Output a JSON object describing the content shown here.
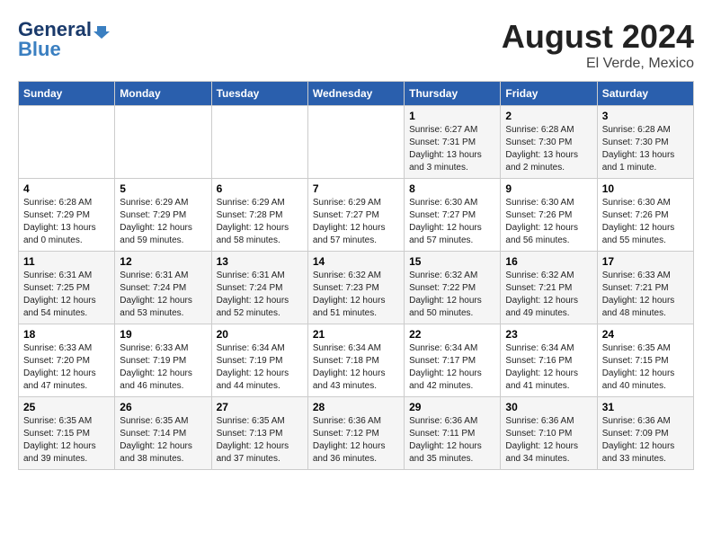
{
  "logo": {
    "general": "General",
    "blue": "Blue"
  },
  "title": {
    "month_year": "August 2024",
    "location": "El Verde, Mexico"
  },
  "days_of_week": [
    "Sunday",
    "Monday",
    "Tuesday",
    "Wednesday",
    "Thursday",
    "Friday",
    "Saturday"
  ],
  "weeks": [
    [
      {
        "num": "",
        "info": ""
      },
      {
        "num": "",
        "info": ""
      },
      {
        "num": "",
        "info": ""
      },
      {
        "num": "",
        "info": ""
      },
      {
        "num": "1",
        "info": "Sunrise: 6:27 AM\nSunset: 7:31 PM\nDaylight: 13 hours\nand 3 minutes."
      },
      {
        "num": "2",
        "info": "Sunrise: 6:28 AM\nSunset: 7:30 PM\nDaylight: 13 hours\nand 2 minutes."
      },
      {
        "num": "3",
        "info": "Sunrise: 6:28 AM\nSunset: 7:30 PM\nDaylight: 13 hours\nand 1 minute."
      }
    ],
    [
      {
        "num": "4",
        "info": "Sunrise: 6:28 AM\nSunset: 7:29 PM\nDaylight: 13 hours\nand 0 minutes."
      },
      {
        "num": "5",
        "info": "Sunrise: 6:29 AM\nSunset: 7:29 PM\nDaylight: 12 hours\nand 59 minutes."
      },
      {
        "num": "6",
        "info": "Sunrise: 6:29 AM\nSunset: 7:28 PM\nDaylight: 12 hours\nand 58 minutes."
      },
      {
        "num": "7",
        "info": "Sunrise: 6:29 AM\nSunset: 7:27 PM\nDaylight: 12 hours\nand 57 minutes."
      },
      {
        "num": "8",
        "info": "Sunrise: 6:30 AM\nSunset: 7:27 PM\nDaylight: 12 hours\nand 57 minutes."
      },
      {
        "num": "9",
        "info": "Sunrise: 6:30 AM\nSunset: 7:26 PM\nDaylight: 12 hours\nand 56 minutes."
      },
      {
        "num": "10",
        "info": "Sunrise: 6:30 AM\nSunset: 7:26 PM\nDaylight: 12 hours\nand 55 minutes."
      }
    ],
    [
      {
        "num": "11",
        "info": "Sunrise: 6:31 AM\nSunset: 7:25 PM\nDaylight: 12 hours\nand 54 minutes."
      },
      {
        "num": "12",
        "info": "Sunrise: 6:31 AM\nSunset: 7:24 PM\nDaylight: 12 hours\nand 53 minutes."
      },
      {
        "num": "13",
        "info": "Sunrise: 6:31 AM\nSunset: 7:24 PM\nDaylight: 12 hours\nand 52 minutes."
      },
      {
        "num": "14",
        "info": "Sunrise: 6:32 AM\nSunset: 7:23 PM\nDaylight: 12 hours\nand 51 minutes."
      },
      {
        "num": "15",
        "info": "Sunrise: 6:32 AM\nSunset: 7:22 PM\nDaylight: 12 hours\nand 50 minutes."
      },
      {
        "num": "16",
        "info": "Sunrise: 6:32 AM\nSunset: 7:21 PM\nDaylight: 12 hours\nand 49 minutes."
      },
      {
        "num": "17",
        "info": "Sunrise: 6:33 AM\nSunset: 7:21 PM\nDaylight: 12 hours\nand 48 minutes."
      }
    ],
    [
      {
        "num": "18",
        "info": "Sunrise: 6:33 AM\nSunset: 7:20 PM\nDaylight: 12 hours\nand 47 minutes."
      },
      {
        "num": "19",
        "info": "Sunrise: 6:33 AM\nSunset: 7:19 PM\nDaylight: 12 hours\nand 46 minutes."
      },
      {
        "num": "20",
        "info": "Sunrise: 6:34 AM\nSunset: 7:19 PM\nDaylight: 12 hours\nand 44 minutes."
      },
      {
        "num": "21",
        "info": "Sunrise: 6:34 AM\nSunset: 7:18 PM\nDaylight: 12 hours\nand 43 minutes."
      },
      {
        "num": "22",
        "info": "Sunrise: 6:34 AM\nSunset: 7:17 PM\nDaylight: 12 hours\nand 42 minutes."
      },
      {
        "num": "23",
        "info": "Sunrise: 6:34 AM\nSunset: 7:16 PM\nDaylight: 12 hours\nand 41 minutes."
      },
      {
        "num": "24",
        "info": "Sunrise: 6:35 AM\nSunset: 7:15 PM\nDaylight: 12 hours\nand 40 minutes."
      }
    ],
    [
      {
        "num": "25",
        "info": "Sunrise: 6:35 AM\nSunset: 7:15 PM\nDaylight: 12 hours\nand 39 minutes."
      },
      {
        "num": "26",
        "info": "Sunrise: 6:35 AM\nSunset: 7:14 PM\nDaylight: 12 hours\nand 38 minutes."
      },
      {
        "num": "27",
        "info": "Sunrise: 6:35 AM\nSunset: 7:13 PM\nDaylight: 12 hours\nand 37 minutes."
      },
      {
        "num": "28",
        "info": "Sunrise: 6:36 AM\nSunset: 7:12 PM\nDaylight: 12 hours\nand 36 minutes."
      },
      {
        "num": "29",
        "info": "Sunrise: 6:36 AM\nSunset: 7:11 PM\nDaylight: 12 hours\nand 35 minutes."
      },
      {
        "num": "30",
        "info": "Sunrise: 6:36 AM\nSunset: 7:10 PM\nDaylight: 12 hours\nand 34 minutes."
      },
      {
        "num": "31",
        "info": "Sunrise: 6:36 AM\nSunset: 7:09 PM\nDaylight: 12 hours\nand 33 minutes."
      }
    ]
  ]
}
